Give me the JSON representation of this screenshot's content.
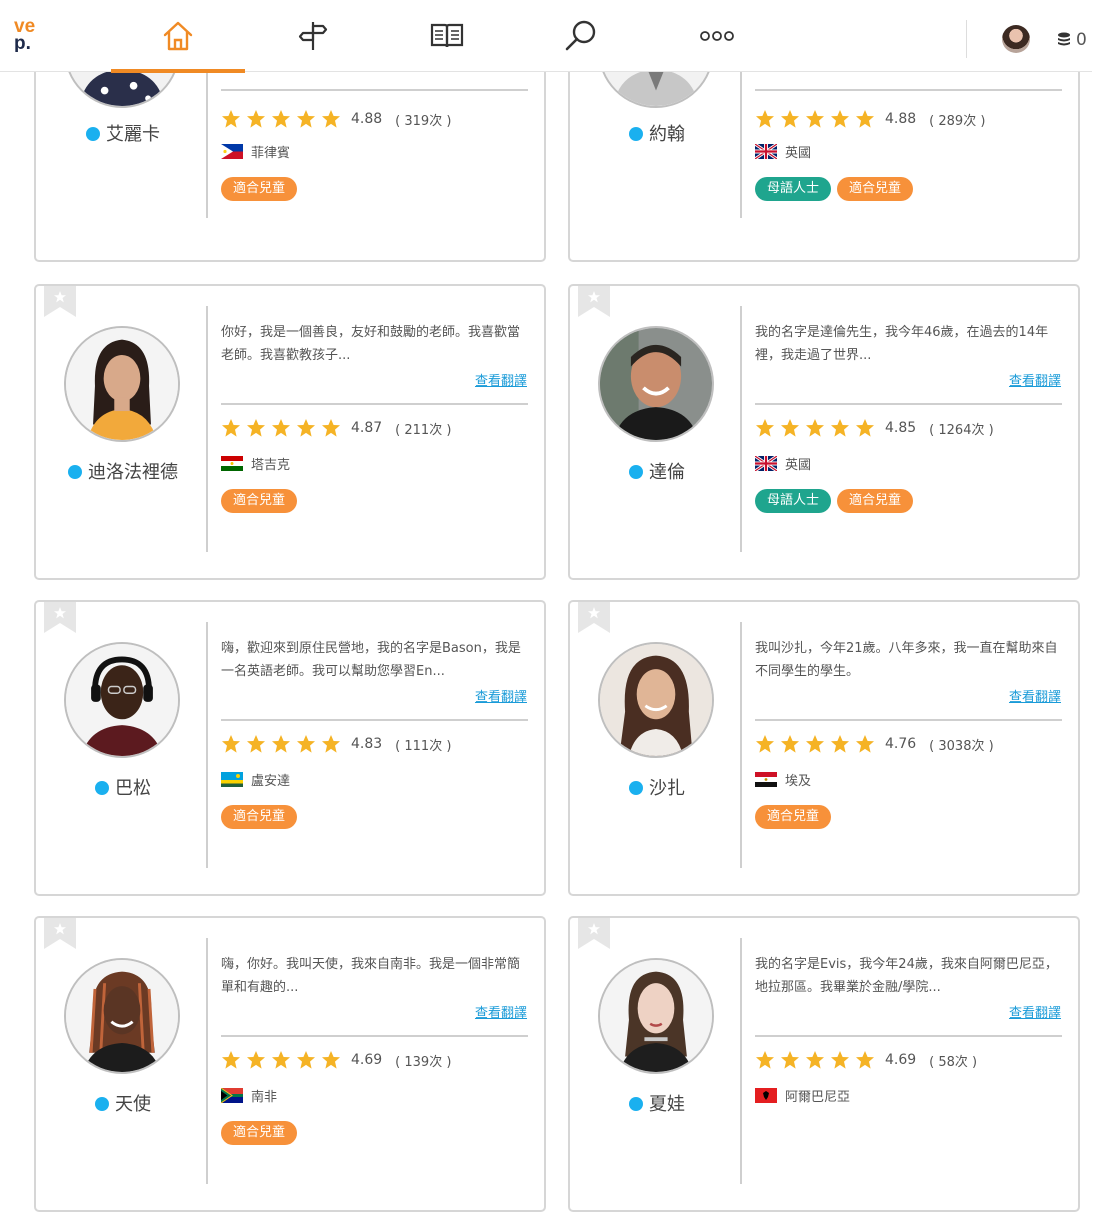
{
  "logo": {
    "line1": "ve",
    "line2": "p."
  },
  "nav": {
    "icons": [
      "home-icon",
      "signpost-icon",
      "book-icon",
      "search-icon",
      "more-icon"
    ],
    "coins": "0"
  },
  "common": {
    "translate_label": "查看翻譯",
    "tag_children": "適合兒童",
    "tag_native": "母語人士"
  },
  "tutors": [
    {
      "name": "艾麗卡",
      "intro": "",
      "rating": "4.88",
      "count": "( 319次 )",
      "country": "菲律賓",
      "tags": [
        "適合兒童"
      ]
    },
    {
      "name": "約翰",
      "intro": "",
      "rating": "4.88",
      "count": "( 289次 )",
      "country": "英國",
      "tags": [
        "母語人士",
        "適合兒童"
      ]
    },
    {
      "name": "迪洛法裡德",
      "intro": "你好，我是一個善良，友好和鼓勵的老師。我喜歡當老師。我喜歡教孩子...",
      "rating": "4.87",
      "count": "( 211次 )",
      "country": "塔吉克",
      "tags": [
        "適合兒童"
      ]
    },
    {
      "name": "達倫",
      "intro": "我的名字是達倫先生，我今年46歲，在過去的14年裡，我走過了世界...",
      "rating": "4.85",
      "count": "( 1264次 )",
      "country": "英國",
      "tags": [
        "母語人士",
        "適合兒童"
      ]
    },
    {
      "name": "巴松",
      "intro": "嗨，歡迎來到原住民營地，我的名字是Bason，我是一名英語老師。我可以幫助您學習En...",
      "rating": "4.83",
      "count": "( 111次 )",
      "country": "盧安達",
      "tags": [
        "適合兒童"
      ]
    },
    {
      "name": "沙扎",
      "intro": "我叫沙扎，今年21歲。八年多來，我一直在幫助來自不同學生的學生。",
      "rating": "4.76",
      "count": "( 3038次 )",
      "country": "埃及",
      "tags": [
        "適合兒童"
      ]
    },
    {
      "name": "天使",
      "intro": "嗨，你好。我叫天使，我來自南非。我是一個非常簡單和有趣的...",
      "rating": "4.69",
      "count": "( 139次 )",
      "country": "南非",
      "tags": [
        "適合兒童"
      ]
    },
    {
      "name": "夏娃",
      "intro": "我的名字是Evis，我今年24歲，我來自阿爾巴尼亞，地拉那區。我畢業於金融/學院...",
      "rating": "4.69",
      "count": "( 58次 )",
      "country": "阿爾巴尼亞",
      "tags": []
    }
  ],
  "colors": {
    "accent": "#f08a24",
    "online_dot": "#1ab0ef",
    "tag_orange": "#f7913a",
    "tag_green": "#1fa58e",
    "link": "#1a9bd8",
    "star": "#f5b325"
  }
}
